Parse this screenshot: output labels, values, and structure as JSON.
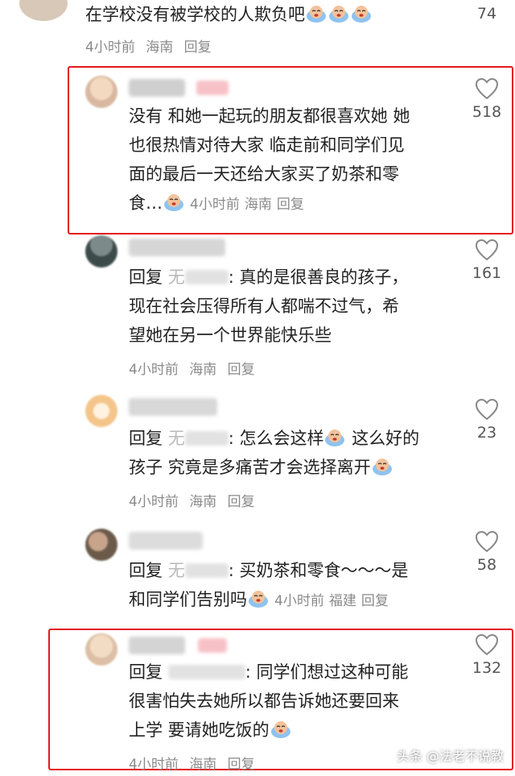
{
  "comments": [
    {
      "line1": "在学校没有被学校的人欺负吧",
      "time": "4小时前",
      "location": "海南",
      "reply": "回复",
      "likes": "74"
    },
    {
      "lines": [
        "没有 和她一起玩的朋友都很喜欢她 她",
        "也很热情对待大家 临走前和同学们见",
        "面的最后一天还给大家买了奶茶和零"
      ],
      "last_line": "食…",
      "time": "4小时前",
      "location": "海南",
      "reply": "回复",
      "likes": "518"
    },
    {
      "reply_kw": "回复",
      "reply_name": "无",
      "line1_rest": ": 真的是很善良的孩子，",
      "lines": [
        "现在社会压得所有人都喘不过气，希",
        "望她在另一个世界能快乐些"
      ],
      "time": "4小时前",
      "location": "海南",
      "reply": "回复",
      "likes": "161"
    },
    {
      "reply_kw": "回复",
      "reply_name": "无",
      "line1_rest": ": 怎么会这样",
      "line1_end": " 这么好的",
      "line2": "孩子 究竟是多痛苦才会选择离开",
      "time": "4小时前",
      "location": "海南",
      "reply": "回复",
      "likes": "23"
    },
    {
      "reply_kw": "回复",
      "reply_name": "无",
      "line1_rest": ": 买奶茶和零食～～～是",
      "line2": "和同学们告别吗",
      "time": "4小时前",
      "location": "福建",
      "reply": "回复",
      "likes": "58"
    },
    {
      "reply_kw": "回复",
      "line1_rest": ": 同学们想过这种可能",
      "line2": "很害怕失去她所以都告诉她还要回来",
      "line3": "上学 要请她吃饭的",
      "time": "4小时前",
      "location": "海南",
      "reply": "回复",
      "likes": "132"
    }
  ],
  "watermark": "头条 @法老不说教",
  "colors": {
    "highlight": "#e5181b",
    "meta": "#8a8a8a",
    "text": "#222222"
  }
}
